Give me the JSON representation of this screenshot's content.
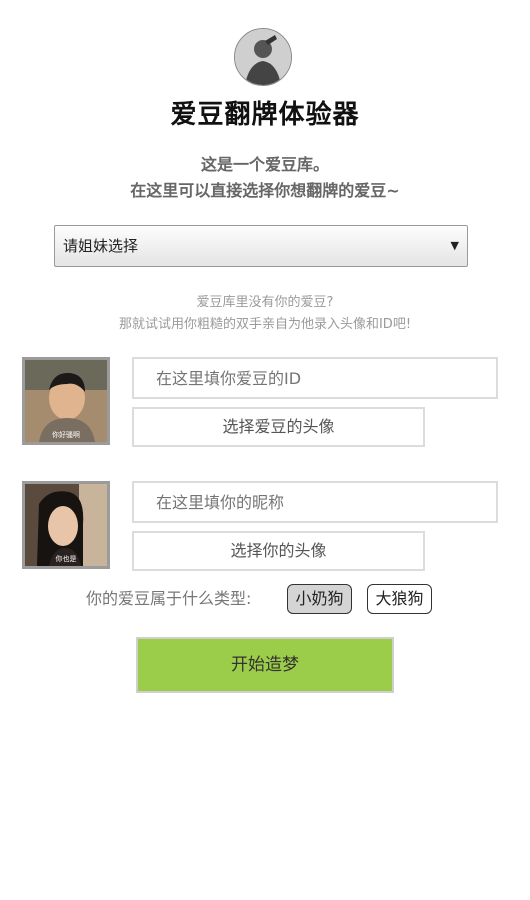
{
  "header": {
    "title": "爱豆翻牌体验器",
    "intro_line1": "这是一个爱豆库。",
    "intro_line2": "在这里可以直接选择你想翻牌的爱豆~"
  },
  "idol_select": {
    "selected": "请姐妹选择",
    "arrow": "▼"
  },
  "hint": {
    "line1": "爱豆库里没有你的爱豆?",
    "line2": "那就试试用你粗糙的双手亲自为他录入头像和ID吧!"
  },
  "idol_entry": {
    "photo_caption": "你好骚啊",
    "id_placeholder": "在这里填你爱豆的ID",
    "avatar_button": "选择爱豆的头像"
  },
  "user_entry": {
    "photo_caption": "你也是",
    "nickname_placeholder": "在这里填你的昵称",
    "avatar_button": "选择你的头像"
  },
  "type_selector": {
    "label": "你的爱豆属于什么类型:",
    "options": [
      "小奶狗",
      "大狼狗"
    ],
    "selected": "小奶狗"
  },
  "start_button": "开始造梦"
}
